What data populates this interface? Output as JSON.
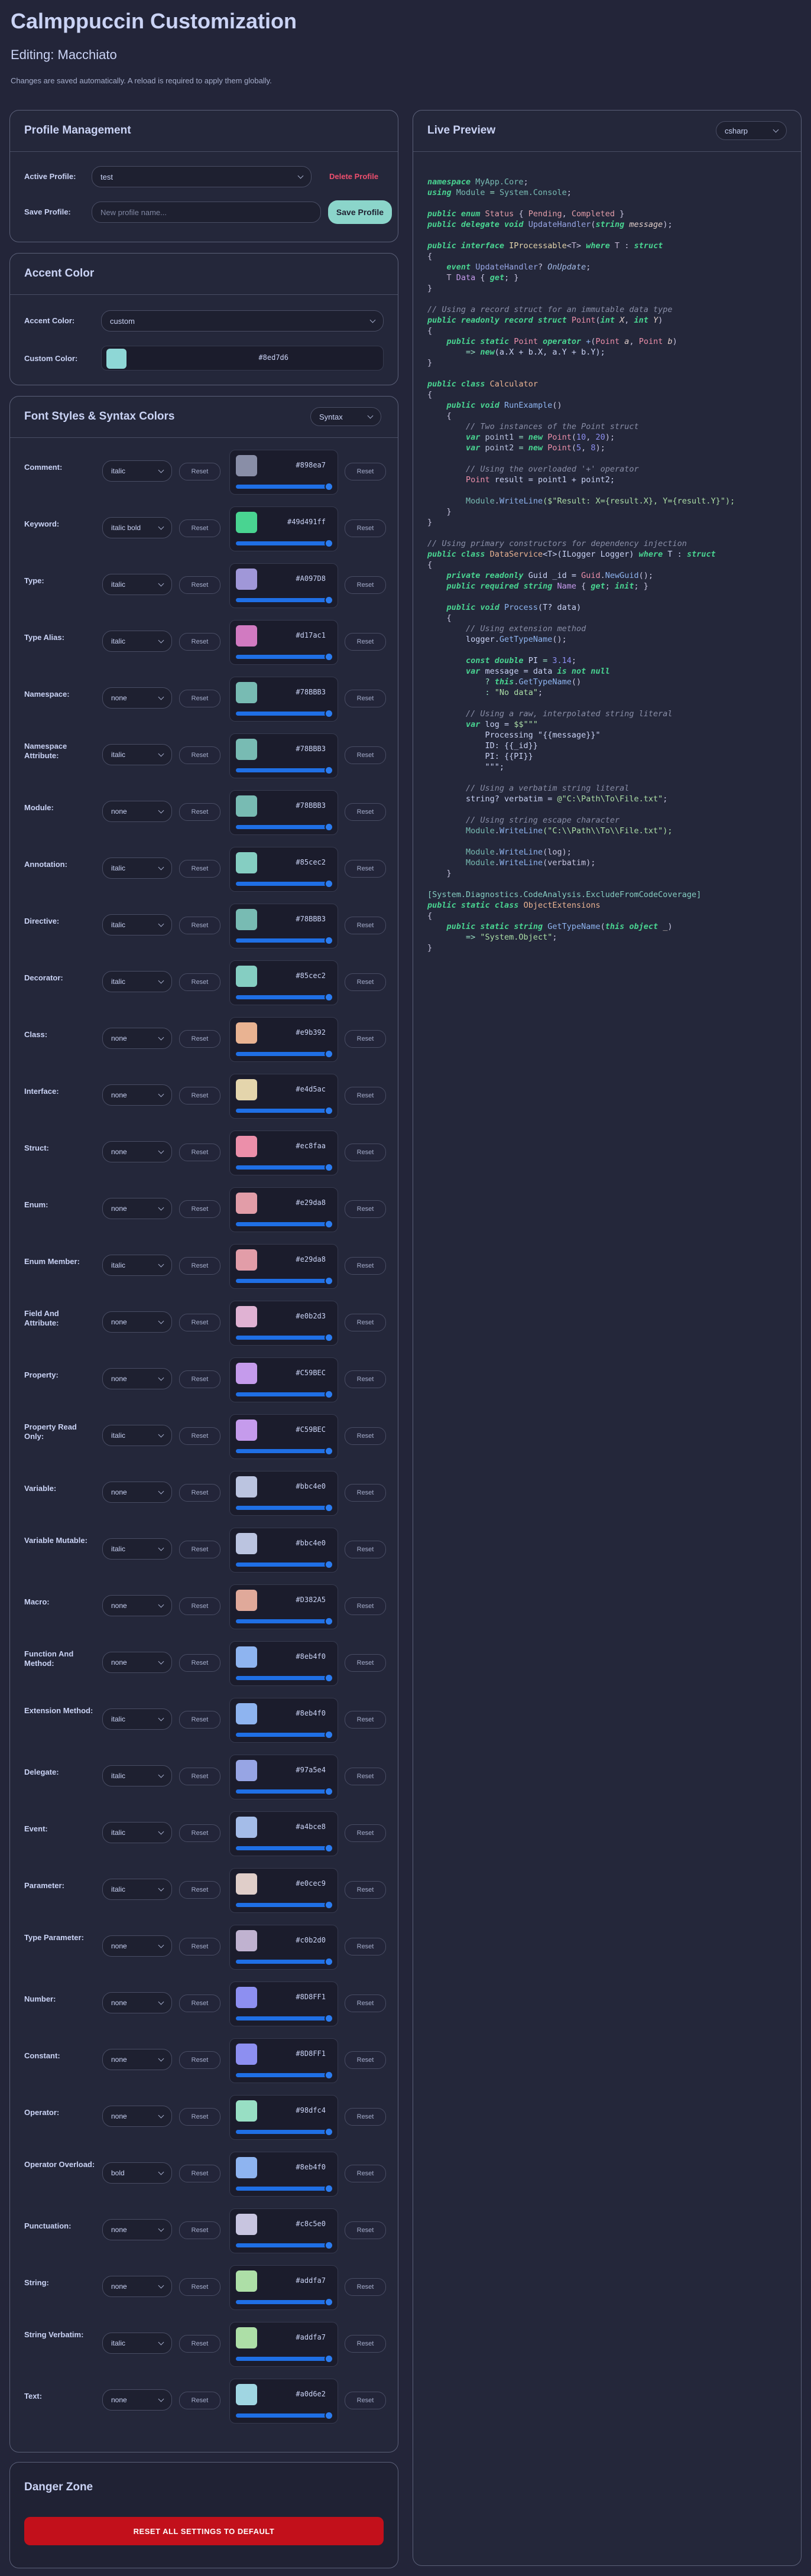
{
  "header": {
    "title": "Calmppuccin Customization",
    "editing": "Editing: Macchiato",
    "note": "Changes are saved automatically. A reload is required to apply them globally."
  },
  "profile": {
    "title": "Profile Management",
    "active_label": "Active Profile:",
    "active_value": "test",
    "delete_label": "Delete Profile",
    "save_label": "Save Profile:",
    "name_placeholder": "New profile name...",
    "save_button": "Save Profile"
  },
  "accent": {
    "title": "Accent Color",
    "accent_label": "Accent Color:",
    "accent_value": "custom",
    "custom_label": "Custom Color:",
    "custom_hex": "#8ed7d6",
    "custom_color": "#8ed7d6"
  },
  "fonts": {
    "title": "Font Styles & Syntax Colors",
    "mode": "Syntax",
    "reset": "Reset",
    "rows": [
      {
        "name": "Comment:",
        "style": "italic",
        "hex": "#898ea7",
        "color": "#898ea7"
      },
      {
        "name": "Keyword:",
        "style": "italic bold",
        "hex": "#49d491ff",
        "color": "#49d491"
      },
      {
        "name": "Type:",
        "style": "italic",
        "hex": "#A097D8",
        "color": "#a097d8"
      },
      {
        "name": "Type Alias:",
        "style": "italic",
        "hex": "#d17ac1",
        "color": "#d17ac1"
      },
      {
        "name": "Namespace:",
        "style": "none",
        "hex": "#78BBB3",
        "color": "#78bbb3"
      },
      {
        "name": "Namespace Attribute:",
        "style": "italic",
        "hex": "#78BBB3",
        "color": "#78bbb3"
      },
      {
        "name": "Module:",
        "style": "none",
        "hex": "#78BBB3",
        "color": "#78bbb3"
      },
      {
        "name": "Annotation:",
        "style": "italic",
        "hex": "#85cec2",
        "color": "#85cec2"
      },
      {
        "name": "Directive:",
        "style": "italic",
        "hex": "#78BBB3",
        "color": "#78bbb3"
      },
      {
        "name": "Decorator:",
        "style": "italic",
        "hex": "#85cec2",
        "color": "#85cec2"
      },
      {
        "name": "Class:",
        "style": "none",
        "hex": "#e9b392",
        "color": "#e9b392"
      },
      {
        "name": "Interface:",
        "style": "none",
        "hex": "#e4d5ac",
        "color": "#e4d5ac"
      },
      {
        "name": "Struct:",
        "style": "none",
        "hex": "#ec8faa",
        "color": "#ec8faa"
      },
      {
        "name": "Enum:",
        "style": "none",
        "hex": "#e29da8",
        "color": "#e29da8"
      },
      {
        "name": "Enum Member:",
        "style": "italic",
        "hex": "#e29da8",
        "color": "#e29da8"
      },
      {
        "name": "Field And Attribute:",
        "style": "none",
        "hex": "#e0b2d3",
        "color": "#e0b2d3"
      },
      {
        "name": "Property:",
        "style": "none",
        "hex": "#C59BEC",
        "color": "#c59bec"
      },
      {
        "name": "Property Read Only:",
        "style": "italic",
        "hex": "#C59BEC",
        "color": "#c59bec"
      },
      {
        "name": "Variable:",
        "style": "none",
        "hex": "#bbc4e0",
        "color": "#bbc4e0"
      },
      {
        "name": "Variable Mutable:",
        "style": "italic",
        "hex": "#bbc4e0",
        "color": "#bbc4e0"
      },
      {
        "name": "Macro:",
        "style": "none",
        "hex": "#D382A5",
        "color": "#e0a99a"
      },
      {
        "name": "Function And Method:",
        "style": "none",
        "hex": "#8eb4f0",
        "color": "#8eb4f0"
      },
      {
        "name": "Extension Method:",
        "style": "italic",
        "hex": "#8eb4f0",
        "color": "#8eb4f0"
      },
      {
        "name": "Delegate:",
        "style": "italic",
        "hex": "#97a5e4",
        "color": "#97a5e4"
      },
      {
        "name": "Event:",
        "style": "italic",
        "hex": "#a4bce8",
        "color": "#a4bce8"
      },
      {
        "name": "Parameter:",
        "style": "italic",
        "hex": "#e0cec9",
        "color": "#e0cec9"
      },
      {
        "name": "Type Parameter:",
        "style": "none",
        "hex": "#c0b2d0",
        "color": "#c0b2d0"
      },
      {
        "name": "Number:",
        "style": "none",
        "hex": "#8D8FF1",
        "color": "#8d8ff1"
      },
      {
        "name": "Constant:",
        "style": "none",
        "hex": "#8D8FF1",
        "color": "#8d8ff1"
      },
      {
        "name": "Operator:",
        "style": "none",
        "hex": "#98dfc4",
        "color": "#98dfc4"
      },
      {
        "name": "Operator Overload:",
        "style": "bold",
        "hex": "#8eb4f0",
        "color": "#8eb4f0"
      },
      {
        "name": "Punctuation:",
        "style": "none",
        "hex": "#c8c5e0",
        "color": "#c8c5e0"
      },
      {
        "name": "String:",
        "style": "none",
        "hex": "#addfa7",
        "color": "#addfa7"
      },
      {
        "name": "String Verbatim:",
        "style": "italic",
        "hex": "#addfa7",
        "color": "#addfa7"
      },
      {
        "name": "Text:",
        "style": "none",
        "hex": "#a0d6e2",
        "color": "#a0d6e2"
      }
    ]
  },
  "danger": {
    "title": "Danger Zone",
    "button": "RESET ALL SETTINGS TO DEFAULT"
  },
  "preview": {
    "title": "Live Preview",
    "language": "csharp",
    "colors": {
      "kw": "#49d491",
      "ns": "#78bbb3",
      "mod": "#78bbb3",
      "type": "#a097d8",
      "struct": "#ec8faa",
      "iface": "#e4d5ac",
      "cls": "#e9b392",
      "enumm": "#e29da8",
      "method": "#8eb4f0",
      "param": "#e0cec9",
      "prop": "#c59bec",
      "field": "#e0b2d3",
      "var": "#bbc4e0",
      "str": "#addfa7",
      "num": "#8d8ff1",
      "cm": "#898ea7",
      "op": "#98dfc4",
      "punc": "#c8c5e0",
      "text": "#cad3f5",
      "attr": "#85cec2",
      "deleg": "#97a5e4",
      "event": "#a4bce8",
      "tparam": "#c0b2d0"
    },
    "code": [
      [
        [
          "namespace ",
          "kw"
        ],
        [
          "MyApp.Core",
          "ns"
        ],
        [
          ";",
          "punc"
        ]
      ],
      [
        [
          "using ",
          "kw"
        ],
        [
          "Module",
          "mod"
        ],
        [
          " = ",
          "op"
        ],
        [
          "System.Console",
          "ns"
        ],
        [
          ";",
          "punc"
        ]
      ],
      [],
      [
        [
          "public enum ",
          "kw"
        ],
        [
          "Status",
          "enumm"
        ],
        [
          " { ",
          "punc"
        ],
        [
          "Pending",
          "enumm"
        ],
        [
          ", ",
          "punc"
        ],
        [
          "Completed",
          "enumm"
        ],
        [
          " }",
          "punc"
        ]
      ],
      [
        [
          "public delegate void ",
          "kw"
        ],
        [
          "UpdateHandler",
          "deleg"
        ],
        [
          "(",
          "punc"
        ],
        [
          "string ",
          "kw"
        ],
        [
          "message",
          "param"
        ],
        [
          ");",
          "punc"
        ]
      ],
      [],
      [
        [
          "public interface ",
          "kw"
        ],
        [
          "IProcessable",
          "iface"
        ],
        [
          "<",
          "punc"
        ],
        [
          "T",
          "tparam"
        ],
        [
          "> ",
          "punc"
        ],
        [
          "where ",
          "kw"
        ],
        [
          "T",
          "tparam"
        ],
        [
          " : ",
          "punc"
        ],
        [
          "struct",
          "kw"
        ]
      ],
      [
        [
          "{",
          "punc"
        ]
      ],
      [
        [
          "    event ",
          "kw"
        ],
        [
          "UpdateHandler",
          "deleg"
        ],
        [
          "? ",
          "punc"
        ],
        [
          "OnUpdate",
          "event"
        ],
        [
          ";",
          "punc"
        ]
      ],
      [
        [
          "    T ",
          "tparam"
        ],
        [
          "Data",
          "prop"
        ],
        [
          " { ",
          "punc"
        ],
        [
          "get",
          "kw"
        ],
        [
          "; }",
          "punc"
        ]
      ],
      [
        [
          "}",
          "punc"
        ]
      ],
      [],
      [
        [
          "// Using a record struct for an immutable data type",
          "cm"
        ]
      ],
      [
        [
          "public readonly record struct ",
          "kw"
        ],
        [
          "Point",
          "struct"
        ],
        [
          "(",
          "punc"
        ],
        [
          "int ",
          "kw"
        ],
        [
          "X",
          "param"
        ],
        [
          ", ",
          "punc"
        ],
        [
          "int ",
          "kw"
        ],
        [
          "Y",
          "param"
        ],
        [
          ")",
          "punc"
        ]
      ],
      [
        [
          "{",
          "punc"
        ]
      ],
      [
        [
          "    public static ",
          "kw"
        ],
        [
          "Point",
          "struct"
        ],
        [
          " operator ",
          "kw"
        ],
        [
          "+",
          "method"
        ],
        [
          "(",
          "punc"
        ],
        [
          "Point ",
          "struct"
        ],
        [
          "a",
          "param"
        ],
        [
          ", ",
          "punc"
        ],
        [
          "Point ",
          "struct"
        ],
        [
          "b",
          "param"
        ],
        [
          ")",
          "punc"
        ]
      ],
      [
        [
          "        => ",
          "op"
        ],
        [
          "new",
          "kw"
        ],
        [
          "(a.X + b.X, a.Y + b.Y);",
          "text"
        ]
      ],
      [
        [
          "}",
          "punc"
        ]
      ],
      [],
      [
        [
          "public class ",
          "kw"
        ],
        [
          "Calculator",
          "cls"
        ]
      ],
      [
        [
          "{",
          "punc"
        ]
      ],
      [
        [
          "    public void ",
          "kw"
        ],
        [
          "RunExample",
          "method"
        ],
        [
          "()",
          "punc"
        ]
      ],
      [
        [
          "    {",
          "punc"
        ]
      ],
      [
        [
          "        // Two instances of the Point struct",
          "cm"
        ]
      ],
      [
        [
          "        var ",
          "kw"
        ],
        [
          "point1",
          "var"
        ],
        [
          " = ",
          "op"
        ],
        [
          "new ",
          "kw"
        ],
        [
          "Point",
          "struct"
        ],
        [
          "(",
          "punc"
        ],
        [
          "10",
          "num"
        ],
        [
          ", ",
          "punc"
        ],
        [
          "20",
          "num"
        ],
        [
          ");",
          "punc"
        ]
      ],
      [
        [
          "        var ",
          "kw"
        ],
        [
          "point2",
          "var"
        ],
        [
          " = ",
          "op"
        ],
        [
          "new ",
          "kw"
        ],
        [
          "Point",
          "struct"
        ],
        [
          "(",
          "punc"
        ],
        [
          "5",
          "num"
        ],
        [
          ", ",
          "punc"
        ],
        [
          "8",
          "num"
        ],
        [
          ");",
          "punc"
        ]
      ],
      [],
      [
        [
          "        // Using the overloaded '+' operator",
          "cm"
        ]
      ],
      [
        [
          "        Point ",
          "struct"
        ],
        [
          "result = point1 + point2;",
          "text"
        ]
      ],
      [],
      [
        [
          "        Module",
          "mod"
        ],
        [
          ".",
          "punc"
        ],
        [
          "WriteLine",
          "method"
        ],
        [
          "($\"Result: X={result.X}, Y={result.Y}\");",
          "str"
        ]
      ],
      [
        [
          "    }",
          "punc"
        ]
      ],
      [
        [
          "}",
          "punc"
        ]
      ],
      [],
      [
        [
          "// Using primary constructors for dependency injection",
          "cm"
        ]
      ],
      [
        [
          "public class ",
          "kw"
        ],
        [
          "DataService",
          "cls"
        ],
        [
          "<T>(ILogger Logger) ",
          "text"
        ],
        [
          "where ",
          "kw"
        ],
        [
          "T : ",
          "text"
        ],
        [
          "struct",
          "kw"
        ]
      ],
      [
        [
          "{",
          "punc"
        ]
      ],
      [
        [
          "    private readonly ",
          "kw"
        ],
        [
          "Guid _id = ",
          "text"
        ],
        [
          "Guid",
          "struct"
        ],
        [
          ".",
          "punc"
        ],
        [
          "NewGuid",
          "method"
        ],
        [
          "();",
          "punc"
        ]
      ],
      [
        [
          "    public required ",
          "kw"
        ],
        [
          "string ",
          "kw"
        ],
        [
          "Name",
          "prop"
        ],
        [
          " { ",
          "punc"
        ],
        [
          "get",
          "kw"
        ],
        [
          "; ",
          "punc"
        ],
        [
          "init",
          "kw"
        ],
        [
          "; }",
          "punc"
        ]
      ],
      [],
      [
        [
          "    public void ",
          "kw"
        ],
        [
          "Process",
          "method"
        ],
        [
          "(T? data)",
          "text"
        ]
      ],
      [
        [
          "    {",
          "punc"
        ]
      ],
      [
        [
          "        // Using extension method",
          "cm"
        ]
      ],
      [
        [
          "        logger.",
          "text"
        ],
        [
          "GetTypeName",
          "method"
        ],
        [
          "();",
          "punc"
        ]
      ],
      [],
      [
        [
          "        const double ",
          "kw"
        ],
        [
          "PI",
          "text"
        ],
        [
          " = ",
          "op"
        ],
        [
          "3.14",
          "num"
        ],
        [
          ";",
          "punc"
        ]
      ],
      [
        [
          "        var ",
          "kw"
        ],
        [
          "message = data ",
          "text"
        ],
        [
          "is not null",
          "kw"
        ]
      ],
      [
        [
          "            ? ",
          "op"
        ],
        [
          "this",
          "kw"
        ],
        [
          ".",
          "punc"
        ],
        [
          "GetTypeName",
          "method"
        ],
        [
          "()",
          "punc"
        ]
      ],
      [
        [
          "            : ",
          "op"
        ],
        [
          "\"No data\"",
          "str"
        ],
        [
          ";",
          "punc"
        ]
      ],
      [],
      [
        [
          "        // Using a raw, interpolated string literal",
          "cm"
        ]
      ],
      [
        [
          "        var ",
          "kw"
        ],
        [
          "log = ",
          "text"
        ],
        [
          "$$\"\"\"",
          "str"
        ]
      ],
      [
        [
          "            Processing \"{{message}}\"",
          "text"
        ]
      ],
      [
        [
          "            ID: {{_id}}",
          "text"
        ]
      ],
      [
        [
          "            PI: {{PI}}",
          "text"
        ]
      ],
      [
        [
          "            \"\"\";",
          "text"
        ]
      ],
      [],
      [
        [
          "        // Using a verbatim string literal",
          "cm"
        ]
      ],
      [
        [
          "        string? verbatim = ",
          "text"
        ],
        [
          "@\"C:\\Path\\To\\File.txt\"",
          "str"
        ],
        [
          ";",
          "punc"
        ]
      ],
      [],
      [
        [
          "        // Using string escape character",
          "cm"
        ]
      ],
      [
        [
          "        Module",
          "mod"
        ],
        [
          ".",
          "punc"
        ],
        [
          "WriteLine",
          "method"
        ],
        [
          "(\"C:\\\\Path\\\\To\\\\File.txt\");",
          "str"
        ]
      ],
      [],
      [
        [
          "        Module",
          "mod"
        ],
        [
          ".",
          "punc"
        ],
        [
          "WriteLine",
          "method"
        ],
        [
          "(log);",
          "punc"
        ]
      ],
      [
        [
          "        Module",
          "mod"
        ],
        [
          ".",
          "punc"
        ],
        [
          "WriteLine",
          "method"
        ],
        [
          "(verbatim);",
          "punc"
        ]
      ],
      [
        [
          "    }",
          "punc"
        ]
      ],
      [],
      [
        [
          "[System.Diagnostics.CodeAnalysis.ExcludeFromCodeCoverage]",
          "attr"
        ]
      ],
      [
        [
          "public static class ",
          "kw"
        ],
        [
          "ObjectExtensions",
          "cls"
        ]
      ],
      [
        [
          "{",
          "punc"
        ]
      ],
      [
        [
          "    public static ",
          "kw"
        ],
        [
          "string ",
          "kw"
        ],
        [
          "GetTypeName",
          "method"
        ],
        [
          "(",
          "punc"
        ],
        [
          "this ",
          "kw"
        ],
        [
          "object ",
          "kw"
        ],
        [
          "_",
          "param"
        ],
        [
          ")",
          "punc"
        ]
      ],
      [
        [
          "        => ",
          "op"
        ],
        [
          "\"System.Object\"",
          "str"
        ],
        [
          ";",
          "punc"
        ]
      ],
      [
        [
          "}",
          "punc"
        ]
      ]
    ]
  }
}
